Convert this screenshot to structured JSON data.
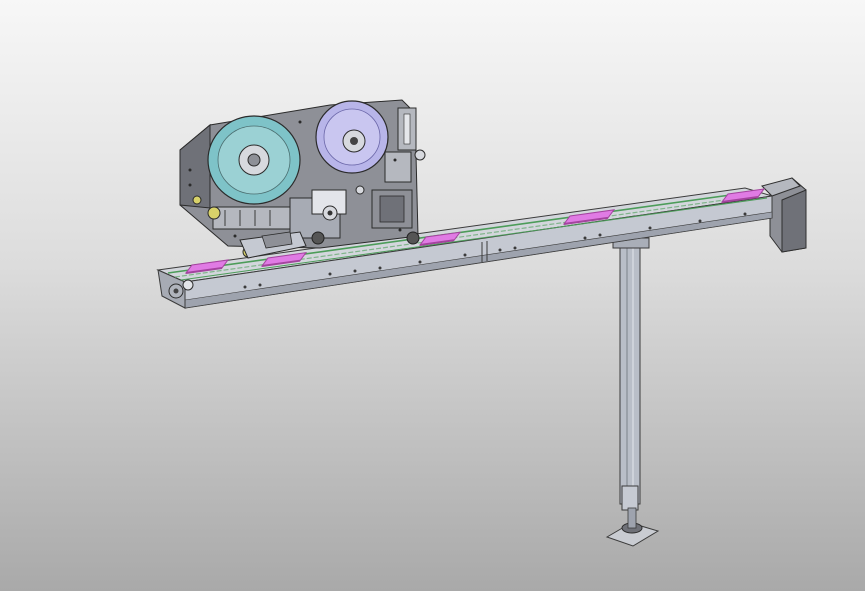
{
  "viewport": {
    "background_top": "#f7f7f7",
    "background_bottom": "#a9a9a9"
  },
  "model": {
    "label_count": 6,
    "colors": {
      "frame": "#c5c9d2",
      "frame_shadow": "#9ea3ae",
      "edge": "#3b3b3b",
      "plate": "#8e9097",
      "plate_dark": "#6f7178",
      "label": "#e07be4",
      "label_dark": "#a4449f",
      "belt": "#7fb58a",
      "reel_left": "#7ec3c8",
      "reel_right": "#b8b5e9",
      "hub": "#d7d9de",
      "post": "#b9bec8",
      "accent_yellow": "#d8d26a"
    }
  }
}
